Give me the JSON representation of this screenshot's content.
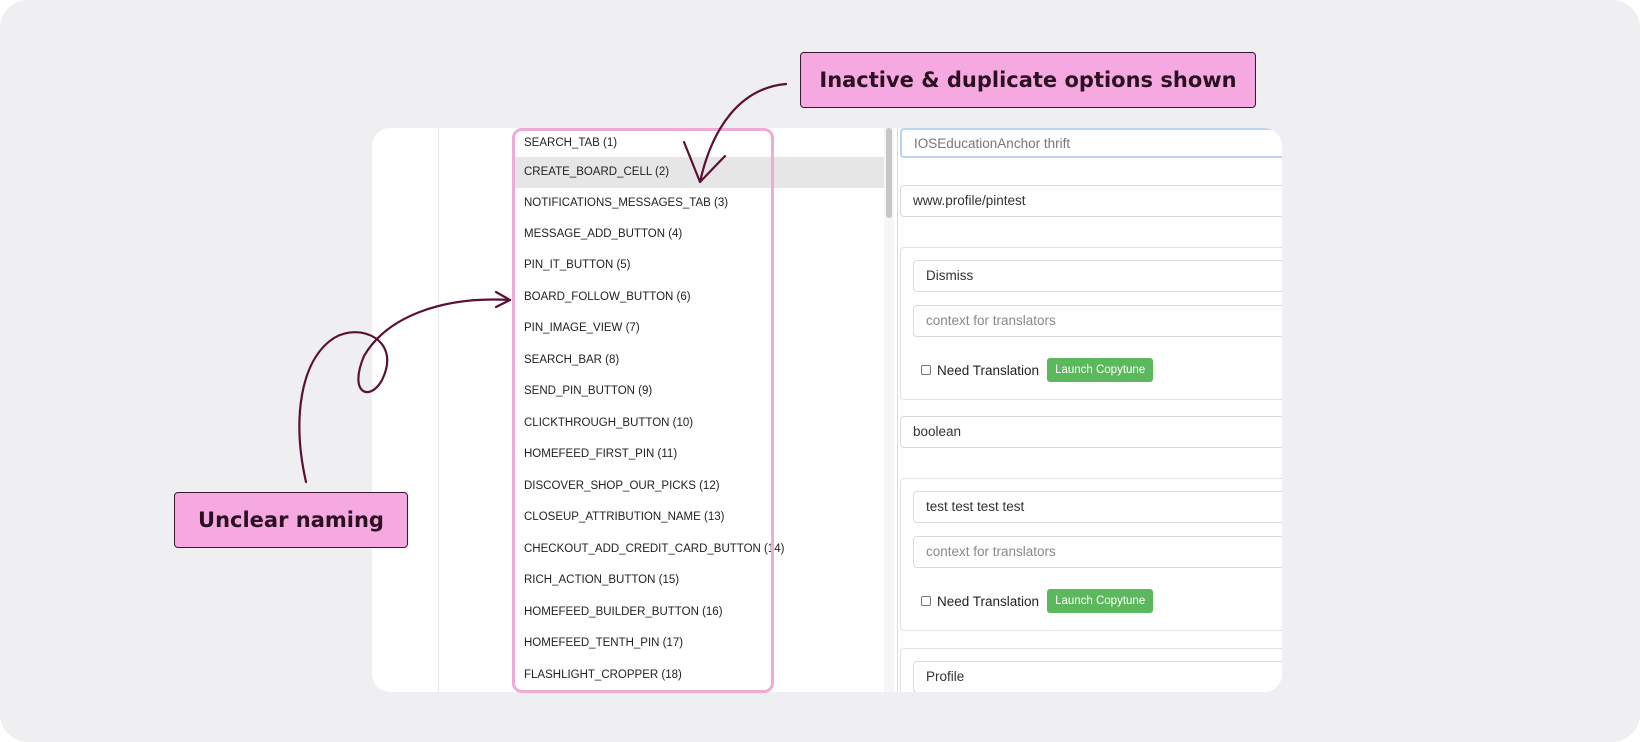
{
  "annotations": {
    "top_callout": "Inactive & duplicate options shown",
    "left_callout": "Unclear naming"
  },
  "dropdown": {
    "options": [
      "SEARCH_TAB (1)",
      "CREATE_BOARD_CELL (2)",
      "NOTIFICATIONS_MESSAGES_TAB (3)",
      "MESSAGE_ADD_BUTTON (4)",
      "PIN_IT_BUTTON (5)",
      "BOARD_FOLLOW_BUTTON (6)",
      "PIN_IMAGE_VIEW (7)",
      "SEARCH_BAR (8)",
      "SEND_PIN_BUTTON (9)",
      "CLICKTHROUGH_BUTTON (10)",
      "HOMEFEED_FIRST_PIN (11)",
      "DISCOVER_SHOP_OUR_PICKS (12)",
      "CLOSEUP_ATTRIBUTION_NAME (13)",
      "CHECKOUT_ADD_CREDIT_CARD_BUTTON (14)",
      "RICH_ACTION_BUTTON (15)",
      "HOMEFEED_BUILDER_BUTTON (16)",
      "HOMEFEED_TENTH_PIN (17)",
      "FLASHLIGHT_CROPPER (18)"
    ],
    "highlighted_index": 1
  },
  "form": {
    "name_value": "IOSEducationAnchor thrift",
    "url_value": "www.profile/pintest",
    "block1": {
      "text_value": "Dismiss",
      "context_placeholder": "context for translators",
      "need_translation_label": "Need Translation",
      "need_translation_checked": false,
      "launch_label": "Launch Copytune"
    },
    "type_value": "boolean",
    "block2": {
      "text_value": "test test test test",
      "context_placeholder": "context for translators",
      "need_translation_label": "Need Translation",
      "need_translation_checked": false,
      "launch_label": "Launch Copytune"
    },
    "profile_value": "Profile"
  },
  "colors": {
    "highlight_pink": "#f6a9e0",
    "arrow": "#5c0f34",
    "button_green": "#5cb85c"
  }
}
